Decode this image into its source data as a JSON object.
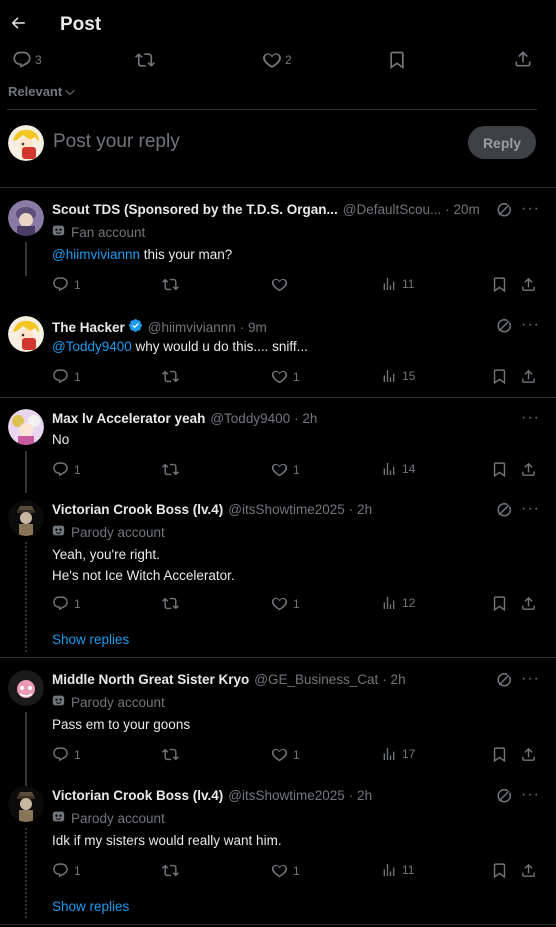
{
  "header": {
    "title": "Post"
  },
  "main_actions": {
    "replies": "3",
    "likes": "2"
  },
  "sort": {
    "label": "Relevant"
  },
  "composer": {
    "placeholder": "Post your reply",
    "button_label": "Reply"
  },
  "colors": {
    "accent": "#1d9bf0",
    "muted": "#71767b",
    "text": "#e7e9ea",
    "divider": "#2f3336"
  },
  "show_replies_label": "Show replies",
  "tweets": [
    {
      "name": "Scout TDS (Sponsored by the T.D.S. Organ...",
      "handle": "@DefaultScou...",
      "time": "· 20m",
      "badge": "Fan account",
      "mention": "@hiimviviannn",
      "text": " this your man?",
      "replies": "1",
      "likes": "",
      "views": "11",
      "avatar_icon": "scout-avatar"
    },
    {
      "name": "The Hacker",
      "handle": "@hiimviviannn",
      "time": "· 9m",
      "mention": "@Toddy9400",
      "text": " why would u do this.... sniff...",
      "replies": "1",
      "likes": "1",
      "views": "15",
      "avatar_icon": "hacker-avatar"
    },
    {
      "name": "Max lv Accelerator yeah",
      "handle": "@Toddy9400",
      "time": "· 2h",
      "text": "No",
      "replies": "1",
      "likes": "1",
      "views": "14",
      "avatar_icon": "max-avatar"
    },
    {
      "name": "Victorian Crook Boss (lv.4)",
      "handle": "@itsShowtime2025",
      "time": "· 2h",
      "badge": "Parody account",
      "text_line1": "Yeah, you're right.",
      "text_line2": "He's not Ice Witch Accelerator.",
      "replies": "1",
      "likes": "1",
      "views": "12",
      "avatar_icon": "crook-avatar"
    },
    {
      "name": "Middle North Great Sister Kryo",
      "handle": "@GE_Business_Cat",
      "time": "· 2h",
      "badge": "Parody account",
      "text": "Pass em to your goons",
      "replies": "1",
      "likes": "1",
      "views": "17",
      "avatar_icon": "kryo-avatar"
    },
    {
      "name": "Victorian Crook Boss (lv.4)",
      "handle": "@itsShowtime2025",
      "time": "· 2h",
      "badge": "Parody account",
      "text": "Idk if my sisters would really want him.",
      "replies": "1",
      "likes": "1",
      "views": "11",
      "avatar_icon": "crook-avatar"
    }
  ]
}
